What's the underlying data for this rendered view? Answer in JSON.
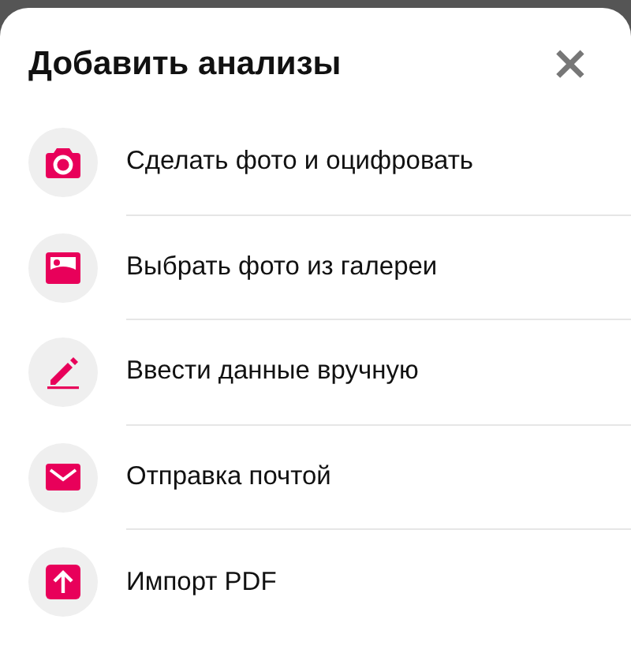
{
  "title": "Добавить анализы",
  "close": "×",
  "items": [
    {
      "kind": "camera",
      "label": "Сделать фото и оцифровать"
    },
    {
      "kind": "gallery",
      "label": "Выбрать фото из галереи"
    },
    {
      "kind": "pen",
      "label": "Ввести данные вручную"
    },
    {
      "kind": "mail",
      "label": "Отправка почтой"
    },
    {
      "kind": "upload",
      "label": "Импорт PDF"
    }
  ]
}
